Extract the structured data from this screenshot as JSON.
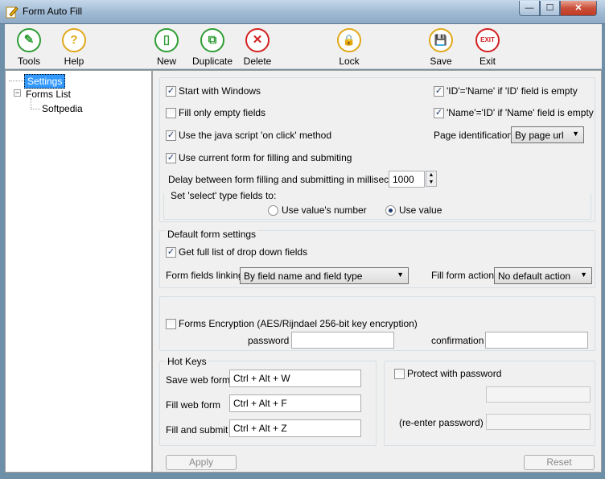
{
  "window": {
    "title": "Form Auto Fill",
    "minimize_glyph": "—",
    "maximize_glyph": "☐",
    "close_glyph": "✕"
  },
  "toolbar": [
    {
      "label": "Tools",
      "icon": "pencil-icon",
      "glyph": "✎",
      "color": "#2e9d35"
    },
    {
      "label": "Help",
      "icon": "question-icon",
      "glyph": "?",
      "color": "#e0a81a"
    },
    {
      "label": "New",
      "icon": "new-document-icon",
      "glyph": "▯",
      "color": "#2e9d35"
    },
    {
      "label": "Duplicate",
      "icon": "duplicate-icon",
      "glyph": "⧉",
      "color": "#2e9d35"
    },
    {
      "label": "Delete",
      "icon": "delete-icon",
      "glyph": "✕",
      "color": "#d32020"
    },
    {
      "label": "Lock",
      "icon": "lock-icon",
      "glyph": "🔒",
      "color": "#e0a81a"
    },
    {
      "label": "Save",
      "icon": "save-icon",
      "glyph": "💾",
      "color": "#e0a81a"
    },
    {
      "label": "Exit",
      "icon": "exit-icon",
      "glyph": "EXIT",
      "color": "#d32020"
    }
  ],
  "tree": {
    "settings": "Settings",
    "forms_list": "Forms List",
    "softpedia": "Softpedia"
  },
  "settings": {
    "start_with_windows": {
      "label": "Start with Windows",
      "checked": true
    },
    "fill_only_empty": {
      "label": "Fill only empty fields",
      "checked": false
    },
    "use_js_onclick": {
      "label": "Use the java script 'on click' method",
      "checked": true
    },
    "use_current_form": {
      "label": "Use current form for filling and submiting",
      "checked": true
    },
    "id_name": {
      "label": "'ID'='Name' if 'ID' field is empty",
      "checked": true
    },
    "name_id": {
      "label": "'Name'='ID' if 'Name' field is empty",
      "checked": true
    },
    "page_identification_label": "Page identification",
    "page_identification_value": "By page url",
    "delay_label": "Delay between form filling and submitting in milliseconds",
    "delay_value": "1000",
    "select_type_label": "Set 'select' type fields to:",
    "radio_number": "Use value's number",
    "radio_value": "Use value",
    "default_form_settings": "Default form settings",
    "get_full_list": {
      "label": "Get full list of drop down fields",
      "checked": true
    },
    "form_fields_linking_label": "Form fields linking",
    "form_fields_linking_value": "By field name and field type",
    "fill_form_action_label": "Fill form action",
    "fill_form_action_value": "No default action",
    "forms_encryption": {
      "label": "Forms Encryption (AES/Rijndael 256-bit key encryption)",
      "checked": false
    },
    "password_label": "password",
    "confirmation_label": "confirmation",
    "hot_keys_label": "Hot Keys",
    "save_web_form_label": "Save web form",
    "save_web_form_value": "Ctrl + Alt + W",
    "fill_web_form_label": "Fill web form",
    "fill_web_form_value": "Ctrl + Alt + F",
    "fill_and_submit_label": "Fill and submit",
    "fill_and_submit_value": "Ctrl + Alt + Z",
    "protect_with_password": {
      "label": "Protect with password",
      "checked": false
    },
    "reenter_password_label": "(re-enter password)",
    "apply": "Apply",
    "reset": "Reset",
    "check_glyph": "✓",
    "dropdown_arrow_glyph": "▼",
    "spin_up_glyph": "▲",
    "spin_down_glyph": "▼",
    "tree_expander_glyph": "−"
  }
}
